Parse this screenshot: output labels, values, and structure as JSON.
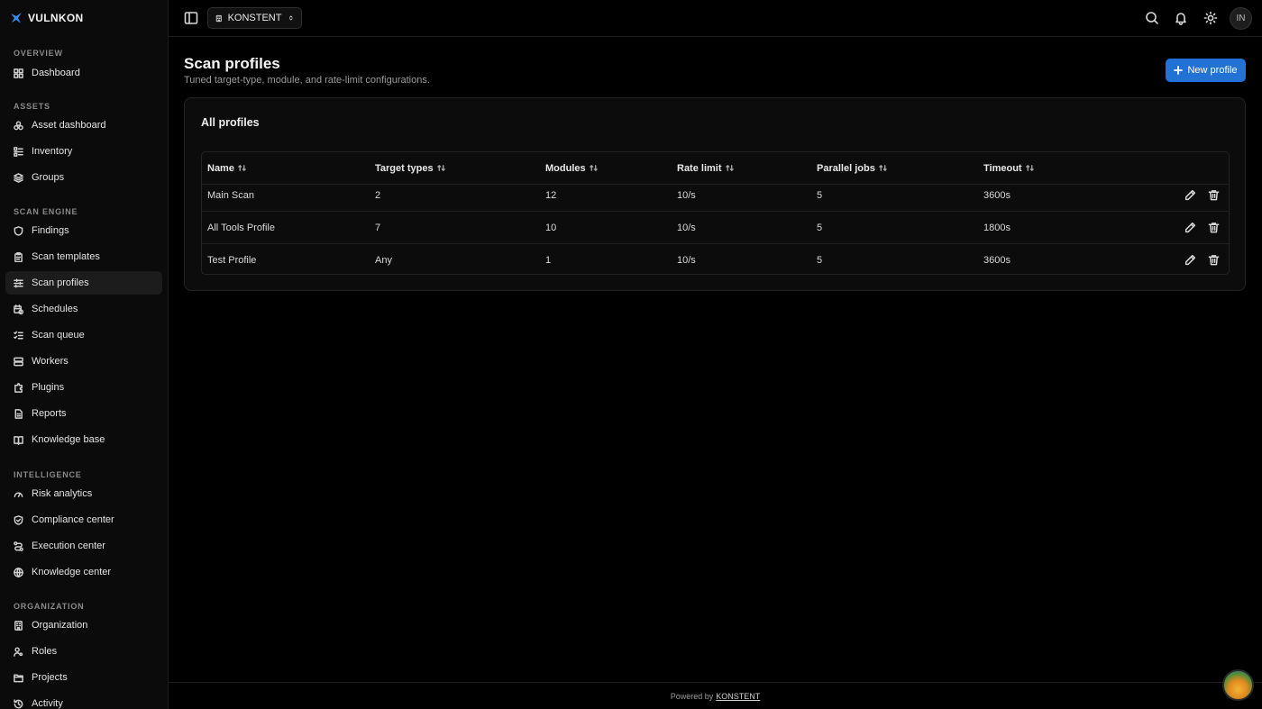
{
  "brand": {
    "name": "VULNKON"
  },
  "sidebar": {
    "sections": [
      {
        "label": "OVERVIEW",
        "items": [
          {
            "label": "Dashboard",
            "icon": "dashboard-icon"
          }
        ]
      },
      {
        "label": "ASSETS",
        "items": [
          {
            "label": "Asset dashboard",
            "icon": "asset-dashboard-icon"
          },
          {
            "label": "Inventory",
            "icon": "inventory-icon"
          },
          {
            "label": "Groups",
            "icon": "layers-icon"
          }
        ]
      },
      {
        "label": "SCAN ENGINE",
        "items": [
          {
            "label": "Findings",
            "icon": "shield-icon"
          },
          {
            "label": "Scan templates",
            "icon": "clipboard-icon"
          },
          {
            "label": "Scan profiles",
            "icon": "sliders-icon"
          },
          {
            "label": "Schedules",
            "icon": "calendar-clock-icon"
          },
          {
            "label": "Scan queue",
            "icon": "list-checks-icon"
          },
          {
            "label": "Workers",
            "icon": "server-icon"
          },
          {
            "label": "Plugins",
            "icon": "puzzle-icon"
          },
          {
            "label": "Reports",
            "icon": "file-icon"
          },
          {
            "label": "Knowledge base",
            "icon": "book-icon"
          }
        ]
      },
      {
        "label": "INTELLIGENCE",
        "items": [
          {
            "label": "Risk analytics",
            "icon": "gauge-icon"
          },
          {
            "label": "Compliance center",
            "icon": "shield-check-icon"
          },
          {
            "label": "Execution center",
            "icon": "route-icon"
          },
          {
            "label": "Knowledge center",
            "icon": "globe-icon"
          }
        ]
      },
      {
        "label": "ORGANIZATION",
        "items": [
          {
            "label": "Organization",
            "icon": "building-icon"
          },
          {
            "label": "Roles",
            "icon": "user-key-icon"
          },
          {
            "label": "Projects",
            "icon": "folder-icon"
          },
          {
            "label": "Activity",
            "icon": "history-icon"
          }
        ]
      }
    ],
    "active": "Scan profiles"
  },
  "topbar": {
    "org_name": "KONSTENT",
    "avatar_initials": "IN"
  },
  "page": {
    "title": "Scan profiles",
    "subtitle": "Tuned target-type, module, and rate-limit configurations.",
    "new_button": "New profile"
  },
  "card": {
    "title": "All profiles"
  },
  "table": {
    "columns": [
      "Name",
      "Target types",
      "Modules",
      "Rate limit",
      "Parallel jobs",
      "Timeout"
    ],
    "rows": [
      [
        "Main Scan",
        "2",
        "12",
        "10/s",
        "5",
        "3600s"
      ],
      [
        "All Tools Profile",
        "7",
        "10",
        "10/s",
        "5",
        "1800s"
      ],
      [
        "Test Profile",
        "Any",
        "1",
        "10/s",
        "5",
        "3600s"
      ]
    ]
  },
  "footer": {
    "prefix": "Powered by",
    "link": "KONSTENT"
  },
  "colors": {
    "accent": "#2272d6",
    "background": "#000000",
    "sidebar": "#0b0b0b"
  }
}
